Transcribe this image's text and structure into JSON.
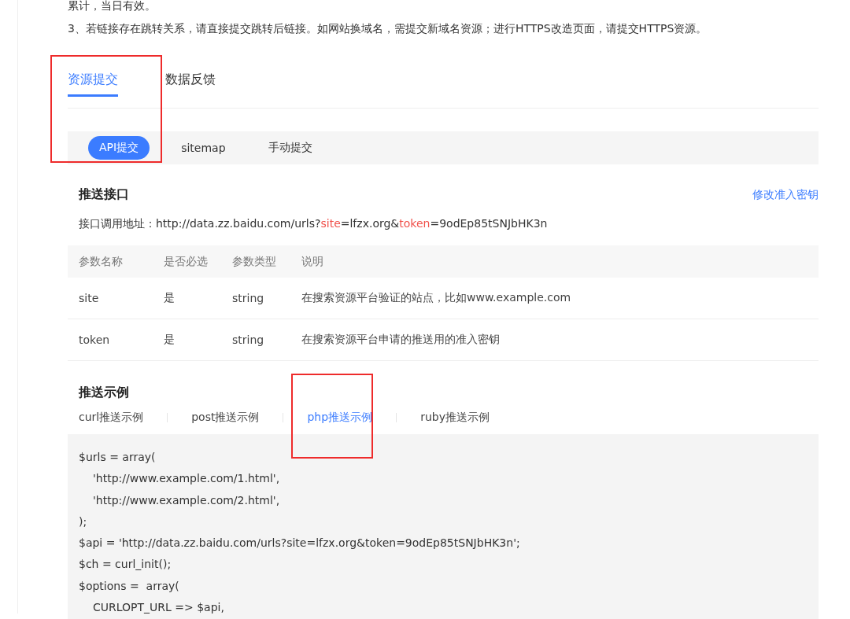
{
  "notes": [
    "累计，当日有效。",
    "3、若链接存在跳转关系，请直接提交跳转后链接。如网站换域名，需提交新域名资源；进行HTTPS改造页面，请提交HTTPS资源。"
  ],
  "tabs": [
    {
      "label": "资源提交",
      "selected": true,
      "outlined": true
    },
    {
      "label": "数据反馈",
      "selected": false,
      "outlined": false
    }
  ],
  "subtabs": [
    {
      "label": "API提交",
      "selected": true
    },
    {
      "label": "sitemap",
      "selected": false
    },
    {
      "label": "手动提交",
      "selected": false
    }
  ],
  "interface": {
    "title": "推送接口",
    "link": "修改准入密钥",
    "address": [
      {
        "text": "接口调用地址：http://data.zz.baidu.com/urls?",
        "highlighted": false
      },
      {
        "text": "site",
        "highlighted": true
      },
      {
        "text": "=lfzx.org&",
        "highlighted": false
      },
      {
        "text": "token",
        "highlighted": true
      },
      {
        "text": "=9odEp85tSNJbHK3n",
        "highlighted": false
      }
    ]
  },
  "table": {
    "columns": [
      "参数名称",
      "是否必选",
      "参数类型",
      "说明"
    ],
    "rows": [
      [
        "site",
        "是",
        "string",
        "在搜索资源平台验证的站点，比如www.example.com"
      ],
      [
        "token",
        "是",
        "string",
        "在搜索资源平台申请的推送用的准入密钥"
      ]
    ]
  },
  "examples": {
    "title": "推送示例",
    "tabs": [
      {
        "label": "curl推送示例",
        "selected": false,
        "outlined": false
      },
      {
        "label": "post推送示例",
        "selected": false,
        "outlined": false
      },
      {
        "label": "php推送示例",
        "selected": true,
        "outlined": true
      },
      {
        "label": "ruby推送示例",
        "selected": false,
        "outlined": false
      }
    ],
    "code": [
      {
        "text": "$urls = array(",
        "indented": false
      },
      {
        "text": "'http://www.example.com/1.html',",
        "indented": true
      },
      {
        "text": "'http://www.example.com/2.html',",
        "indented": true
      },
      {
        "text": ");",
        "indented": false
      },
      {
        "text": "$api = 'http://data.zz.baidu.com/urls?site=lfzx.org&token=9odEp85tSNJbHK3n';",
        "indented": false
      },
      {
        "text": "$ch = curl_init();",
        "indented": false
      },
      {
        "text": "$options =  array(",
        "indented": false
      },
      {
        "text": "CURLOPT_URL => $api,",
        "indented": true
      }
    ]
  }
}
